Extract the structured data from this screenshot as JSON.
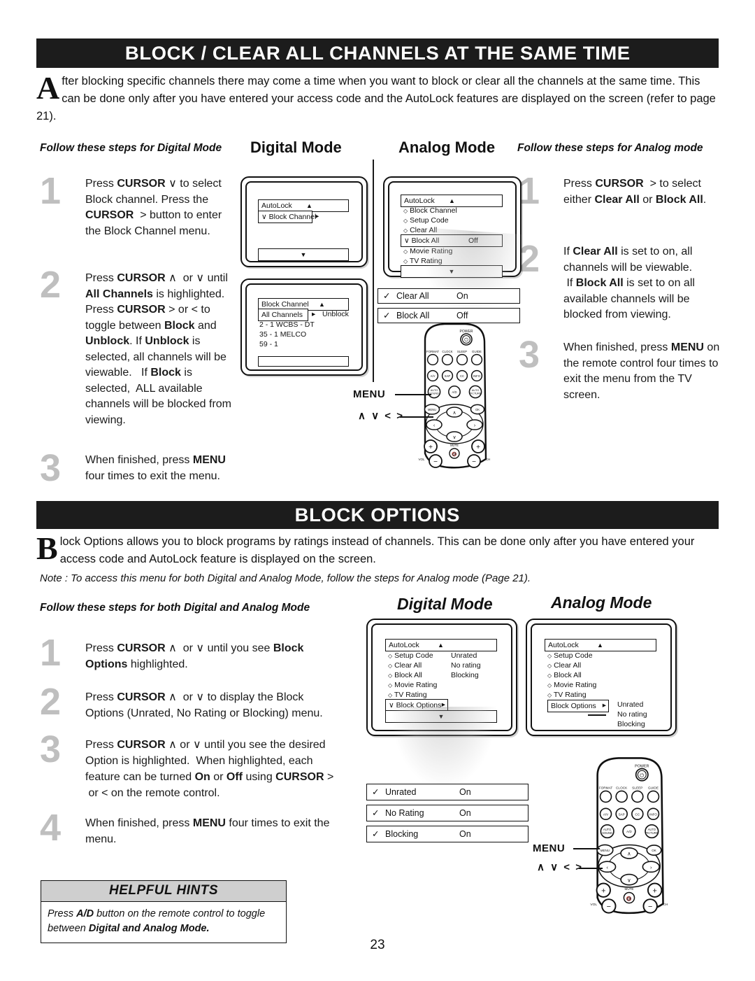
{
  "section1": {
    "banner": "BLOCK / CLEAR ALL CHANNELS AT THE SAME TIME",
    "intro_dropcap": "A",
    "intro_text": "fter blocking specific channels there may come a time when you want to block or clear all the channels at the same time.  This can be done only after you have entered your access code and the AutoLock features are displayed on the screen (refer to page 21).",
    "left_colhead": "Follow these steps for Digital Mode",
    "right_colhead": "Follow these steps for Analog mode",
    "digital_head": "Digital Mode",
    "analog_head": "Analog Mode",
    "left_steps": [
      {
        "num": "1",
        "html": "Press <b>CURSOR</b> ∨ to select Block channel. Press the <b>CURSOR</b> &nbsp;&gt; button to enter the Block Channel menu."
      },
      {
        "num": "2",
        "html": "Press <b>CURSOR</b> ∧ &nbsp;or ∨ until <b>All Channels</b> is highlighted.&nbsp; Press <b>CURSOR</b> &gt; or &lt; to toggle between <b>Block</b> and <b>Unblock</b>. If <b>Unblock</b> is selected, all channels will be viewable.&nbsp;&nbsp; If <b>Block</b> is selected,&nbsp; ALL available channels will be blocked from viewing."
      },
      {
        "num": "3",
        "html": "When finished, press <b>MENU</b> four times to exit the menu."
      }
    ],
    "right_steps": [
      {
        "num": "1",
        "html": "Press <b>CURSOR</b> &nbsp;&gt; to select either <b>Clear All</b> or <b>Block All</b>."
      },
      {
        "num": "2",
        "html": "If <b>Clear All</b> is set to on, all channels will be viewable.<br>&nbsp;If <b>Block All</b> is set to on all available channels will be blocked from viewing."
      },
      {
        "num": "3",
        "html": "When finished, press <b>MENU</b> on the remote control four times to exit the menu from the TV screen."
      }
    ],
    "digital_screen1": {
      "title": "AutoLock",
      "up_arrow": "▲",
      "selected": "Block Channel",
      "check": "∨",
      "arrow": "▸",
      "down_arrow": "▼"
    },
    "digital_screen2": {
      "title": "Block Channel",
      "up_arrow": "▲",
      "selected": "All Channels",
      "arrow": "▸",
      "state": "Unblock",
      "channels": [
        "2  - 1 WCBS - DT",
        "35 - 1 MELCO",
        "59 - 1"
      ]
    },
    "analog_screen": {
      "title": "AutoLock",
      "up_arrow": "▲",
      "items": [
        "Block Channel",
        "Setup Code",
        "Clear All",
        "Block All",
        "Movie Rating",
        "TV Rating"
      ],
      "bullet": "◇",
      "highlight_index": 3,
      "highlight_check": "∨",
      "highlight_value": "Off",
      "down_arrow": "▼"
    },
    "analog_options": [
      {
        "check": "✓",
        "name": "Clear All",
        "value": "On"
      },
      {
        "check": "✓",
        "name": "Block All",
        "value": "Off"
      }
    ],
    "remote_label_menu": "MENU",
    "remote_label_cursor": "∧  ∨  <  >"
  },
  "section2": {
    "banner": "BLOCK OPTIONS",
    "intro_dropcap": "B",
    "intro_text": "lock Options allows you to block programs by ratings instead of channels.   This can be done only after you have entered your access code and AutoLock feature is displayed on the screen.",
    "note": "Note : To access this menu for both Digital and Analog Mode, follow the steps for Analog mode (Page 21).",
    "colhead": "Follow these steps for both Digital and Analog Mode",
    "digital_head": "Digital Mode",
    "analog_head": "Analog Mode",
    "steps": [
      {
        "num": "1",
        "html": "Press <b>CURSOR</b> ∧ &nbsp;or ∨ until you see <b>Block Options</b> highlighted."
      },
      {
        "num": "2",
        "html": "Press <b>CURSOR</b> ∧ &nbsp;or ∨ to display the Block Options (Unrated, No Rating or Blocking) menu."
      },
      {
        "num": "3",
        "html": "Press <b>CURSOR</b> ∧ or ∨ until you see the desired Option is highlighted.&nbsp; When highlighted, each feature can be turned <b>On</b> or <b>Off</b> using <b>CURSOR</b> &gt; &nbsp;or &lt; on the remote control."
      },
      {
        "num": "4",
        "html": "When finished, press <b>MENU</b> four times to exit the menu."
      }
    ],
    "digital_screen": {
      "title": "AutoLock",
      "up_arrow": "▲",
      "items": [
        "Setup Code",
        "Clear All",
        "Block All",
        "Movie Rating",
        "TV Rating"
      ],
      "bullet": "◇",
      "selected": "Block Options",
      "selected_check": "∨",
      "selected_arrow": "▸",
      "side_values": [
        "Unrated",
        "No rating",
        "Blocking"
      ],
      "down_arrow": "▼"
    },
    "analog_screen": {
      "title": "AutoLock",
      "up_arrow": "▲",
      "items": [
        "Setup Code",
        "Clear All",
        "Block All",
        "Movie Rating",
        "TV Rating"
      ],
      "bullet": "◇",
      "selected": "Block Options",
      "selected_arrow": "▸",
      "side_values": [
        "Unrated",
        "No rating",
        "Blocking"
      ]
    },
    "option_rows": [
      {
        "check": "✓",
        "name": "Unrated",
        "value": "On"
      },
      {
        "check": "✓",
        "name": "No Rating",
        "value": "On"
      },
      {
        "check": "✓",
        "name": "Blocking",
        "value": "On"
      }
    ],
    "remote_label_menu": "MENU",
    "remote_label_cursor": "∧  ∨  <  >"
  },
  "remote": {
    "power": "POWER",
    "row1": [
      "FORMAT",
      "CLOCK",
      "SLEEP",
      "GUIDE"
    ],
    "row2": [
      "A/V",
      "SAP",
      "CC",
      "INFO"
    ],
    "row3": [
      "AUTO SOUND",
      "A/D",
      "AUTO PICTURE"
    ],
    "menu": "MENU",
    "ok": "OK",
    "mute": "MUTE",
    "vol": "VOL",
    "ch": "CH",
    "plus": "+",
    "minus": "−",
    "up": "∧",
    "down": "∨",
    "left": "‹",
    "right": "›"
  },
  "hints": {
    "title": "HELPFUL HINTS",
    "body_html": "Press <b><i>A/D</i></b> button on the remote control to toggle between <b><i>Digital and Analog Mode.</i></b>"
  },
  "page_number": "23"
}
